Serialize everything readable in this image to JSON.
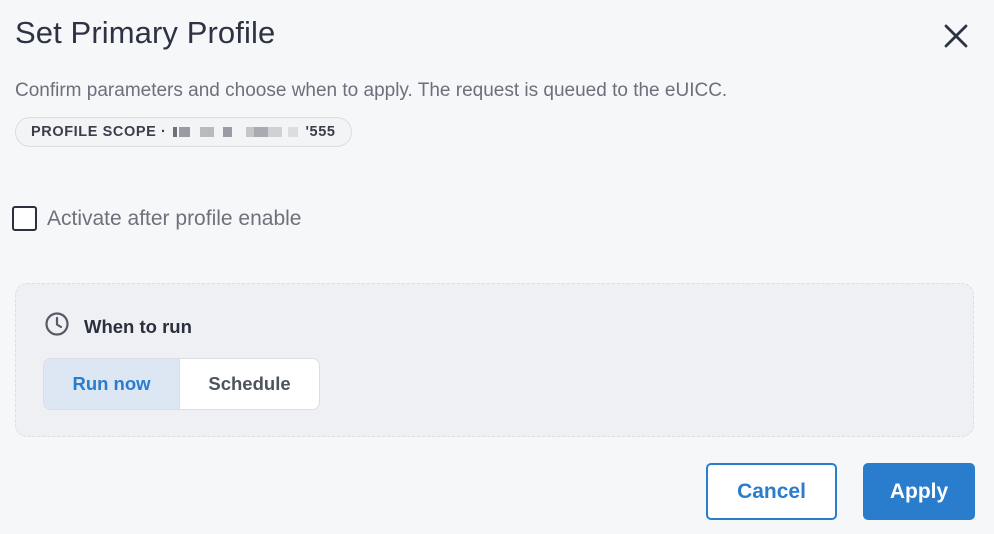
{
  "dialog": {
    "title": "Set Primary Profile",
    "description": "Confirm parameters and choose when to apply. The request is queued to the eUICC.",
    "scope": {
      "label": "PROFILE SCOPE ·",
      "suffix": "'555"
    },
    "activate_checkbox": {
      "label": "Activate after profile enable",
      "checked": false
    },
    "when_to_run": {
      "title": "When to run",
      "icon": "clock-icon",
      "options": [
        "Run now",
        "Schedule"
      ],
      "selected": "Run now"
    },
    "buttons": {
      "cancel": "Cancel",
      "apply": "Apply"
    }
  },
  "colors": {
    "accent": "#2a7ccc",
    "background": "#f6f7f9",
    "panel": "#eef0f3"
  }
}
